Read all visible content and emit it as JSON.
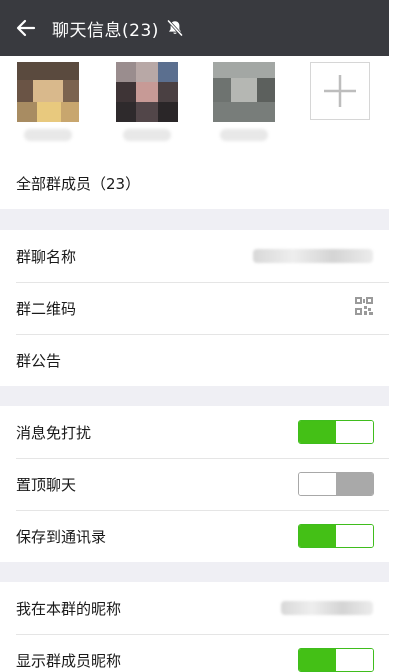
{
  "header": {
    "title": "聊天信息(23)",
    "back_icon": "arrow-left-icon",
    "mute_icon": "bell-muted-icon"
  },
  "members": {
    "avatars": [
      "member-avatar-1",
      "member-avatar-2",
      "member-avatar-3"
    ],
    "add_icon": "plus-icon"
  },
  "all_members": {
    "label": "全部群成员（23）"
  },
  "group_info": {
    "name_label": "群聊名称",
    "qrcode_label": "群二维码",
    "qrcode_icon": "qr-code-icon",
    "notice_label": "群公告"
  },
  "settings": {
    "mute_label": "消息免打扰",
    "mute_on": true,
    "pin_label": "置顶聊天",
    "pin_on": false,
    "save_label": "保存到通讯录",
    "save_on": true
  },
  "profile": {
    "nickname_label": "我在本群的昵称",
    "show_nickname_label": "显示群成员昵称",
    "show_nickname_on": true
  },
  "colors": {
    "topbar": "#393a3f",
    "toggle_on": "#44c016",
    "toggle_off": "#a9a9a9",
    "background": "#efeff4"
  }
}
